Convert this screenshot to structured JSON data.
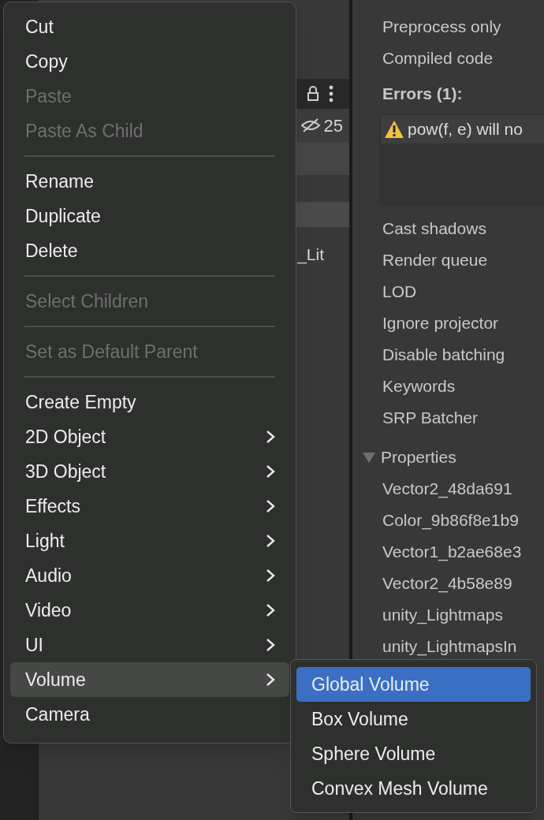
{
  "hierarchy": {
    "visible_count": "25",
    "row_text": "_Lit"
  },
  "inspector": {
    "rows_top": [
      "Preprocess only",
      "Compiled code"
    ],
    "errors_title": "Errors (1):",
    "errors": [
      "pow(f, e) will no"
    ],
    "rows": [
      "Cast shadows",
      "Render queue",
      "LOD",
      "Ignore projector",
      "Disable batching",
      "Keywords",
      "SRP Batcher"
    ],
    "properties": {
      "label": "Properties",
      "expanded": true,
      "items": [
        "Vector2_48da691",
        "Color_9b86f8e1b9",
        "Vector1_b2ae68e3",
        "Vector2_4b58e89",
        "unity_Lightmaps",
        "unity_LightmapsIn"
      ]
    }
  },
  "context_menu": [
    {
      "kind": "item",
      "label": "Cut",
      "disabled": false,
      "submenu": false,
      "selected": false
    },
    {
      "kind": "item",
      "label": "Copy",
      "disabled": false,
      "submenu": false,
      "selected": false
    },
    {
      "kind": "item",
      "label": "Paste",
      "disabled": true,
      "submenu": false,
      "selected": false
    },
    {
      "kind": "item",
      "label": "Paste As Child",
      "disabled": true,
      "submenu": false,
      "selected": false
    },
    {
      "kind": "separator"
    },
    {
      "kind": "item",
      "label": "Rename",
      "disabled": false,
      "submenu": false,
      "selected": false
    },
    {
      "kind": "item",
      "label": "Duplicate",
      "disabled": false,
      "submenu": false,
      "selected": false
    },
    {
      "kind": "item",
      "label": "Delete",
      "disabled": false,
      "submenu": false,
      "selected": false
    },
    {
      "kind": "separator"
    },
    {
      "kind": "item",
      "label": "Select Children",
      "disabled": true,
      "submenu": false,
      "selected": false
    },
    {
      "kind": "separator"
    },
    {
      "kind": "item",
      "label": "Set as Default Parent",
      "disabled": true,
      "submenu": false,
      "selected": false
    },
    {
      "kind": "separator"
    },
    {
      "kind": "item",
      "label": "Create Empty",
      "disabled": false,
      "submenu": false,
      "selected": false
    },
    {
      "kind": "item",
      "label": "2D Object",
      "disabled": false,
      "submenu": true,
      "selected": false
    },
    {
      "kind": "item",
      "label": "3D Object",
      "disabled": false,
      "submenu": true,
      "selected": false
    },
    {
      "kind": "item",
      "label": "Effects",
      "disabled": false,
      "submenu": true,
      "selected": false
    },
    {
      "kind": "item",
      "label": "Light",
      "disabled": false,
      "submenu": true,
      "selected": false
    },
    {
      "kind": "item",
      "label": "Audio",
      "disabled": false,
      "submenu": true,
      "selected": false
    },
    {
      "kind": "item",
      "label": "Video",
      "disabled": false,
      "submenu": true,
      "selected": false
    },
    {
      "kind": "item",
      "label": "UI",
      "disabled": false,
      "submenu": true,
      "selected": false
    },
    {
      "kind": "item",
      "label": "Volume",
      "disabled": false,
      "submenu": true,
      "selected": true
    },
    {
      "kind": "item",
      "label": "Camera",
      "disabled": false,
      "submenu": false,
      "selected": false
    }
  ],
  "submenu": [
    {
      "label": "Global Volume",
      "selected": true
    },
    {
      "label": "Box Volume",
      "selected": false
    },
    {
      "label": "Sphere Volume",
      "selected": false
    },
    {
      "label": "Convex Mesh Volume",
      "selected": false
    }
  ]
}
